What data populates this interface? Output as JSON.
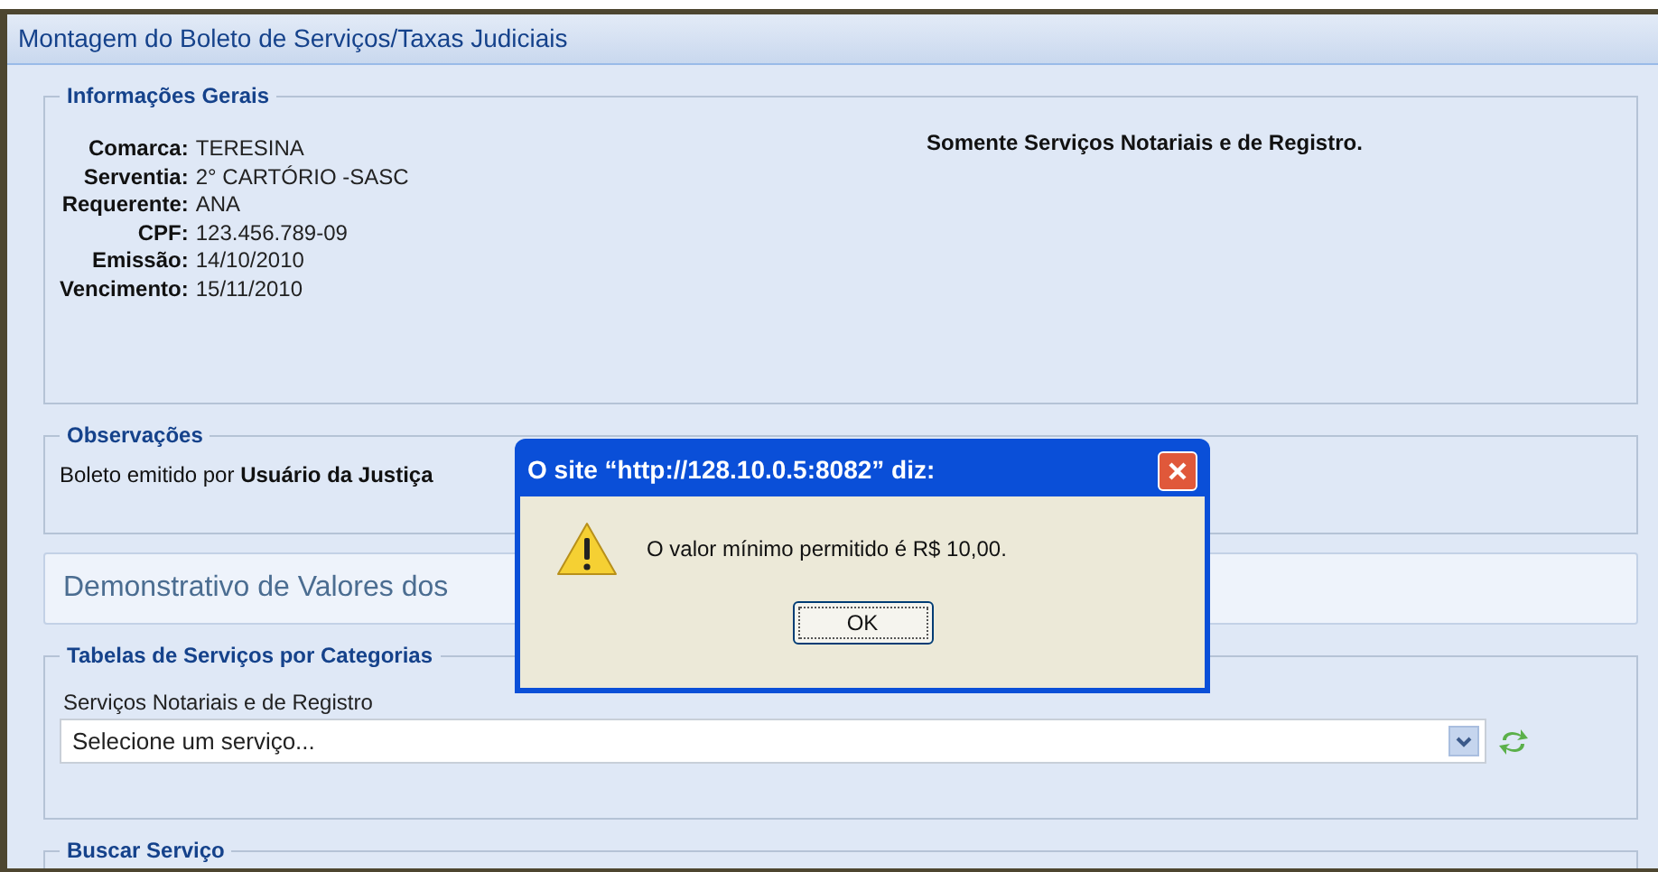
{
  "page": {
    "title": "Montagem do Boleto de Serviços/Taxas Judiciais"
  },
  "general_info": {
    "legend": "Informações Gerais",
    "fields": [
      {
        "label": "Comarca:",
        "value": "TERESINA"
      },
      {
        "label": "Serventia:",
        "value": "2° CARTÓRIO -SASC"
      },
      {
        "label": "Requerente:",
        "value": "ANA"
      },
      {
        "label": "CPF:",
        "value": "123.456.789-09"
      },
      {
        "label": "Emissão:",
        "value": "14/10/2010"
      },
      {
        "label": "Vencimento:",
        "value": "15/11/2010"
      }
    ],
    "note": "Somente Serviços Notariais e de Registro."
  },
  "observations": {
    "legend": "Observações",
    "text": "Boleto emitido por **Usuário da Justiça**"
  },
  "values_panel": {
    "title": "Demonstrativo de Valores dos"
  },
  "service_tables": {
    "legend": "Tabelas de Serviços por Categorias",
    "label": "Serviços Notariais e de Registro",
    "select": {
      "value": "Selecione um serviço..."
    }
  },
  "search_service": {
    "legend": "Buscar Serviço"
  },
  "dialog": {
    "title": "O site “http://128.10.0.5:8082” diz:",
    "message": "O valor mínimo permitido é R$ 10,00.",
    "buttons": [
      "OK"
    ]
  }
}
